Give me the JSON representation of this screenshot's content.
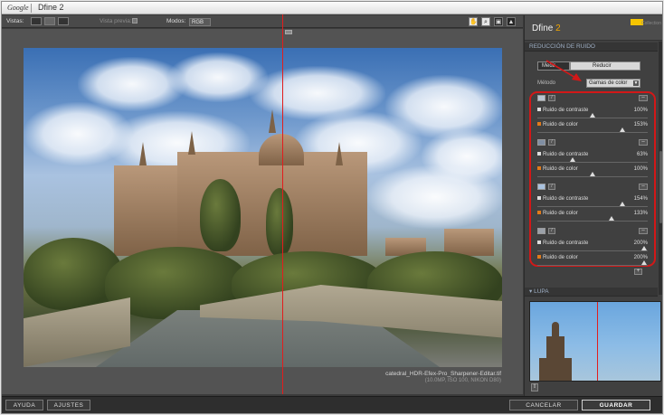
{
  "titlebar": {
    "brand": "Google",
    "title": "Dfine 2"
  },
  "toolbar": {
    "vistas_label": "Vistas:",
    "vista_previa_label": "Vista previa:",
    "modos_label": "Modos:",
    "modo_value": "RGB"
  },
  "photo": {
    "filename": "catedral_HDR-Efex-Pro_Sharpener-Editar.tif",
    "info": "(10.0MP, ISO 100, NIKON D80)"
  },
  "panel": {
    "product_name": "Dfine",
    "product_version": "2",
    "collection_label": "Collection",
    "section_title": "REDUCCIÓN DE RUIDO",
    "tab_medir": "Medir",
    "tab_reducir": "Reducir",
    "metodo_label": "Método",
    "metodo_value": "Gamas de color",
    "groups": [
      {
        "swatch": "#b9c4d1",
        "contrast_label": "Ruido de contraste",
        "contrast_value": "100%",
        "contrast_pos": 0.5,
        "color_label": "Ruido de color",
        "color_value": "153%",
        "color_pos": 0.77
      },
      {
        "swatch": "#7f8ea3",
        "contrast_label": "Ruido de contraste",
        "contrast_value": "63%",
        "contrast_pos": 0.32,
        "color_label": "Ruido de color",
        "color_value": "100%",
        "color_pos": 0.5
      },
      {
        "swatch": "#a8c1de",
        "contrast_label": "Ruido de contraste",
        "contrast_value": "154%",
        "contrast_pos": 0.77,
        "color_label": "Ruido de color",
        "color_value": "133%",
        "color_pos": 0.67
      },
      {
        "swatch": "#9aa0a8",
        "contrast_label": "Ruido de contraste",
        "contrast_value": "200%",
        "contrast_pos": 0.97,
        "color_label": "Ruido de color",
        "color_value": "200%",
        "color_pos": 0.97
      }
    ],
    "lupa_title": "LUPA"
  },
  "bottom": {
    "ayuda": "AYUDA",
    "ajustes": "AJUSTES",
    "cancelar": "CANCELAR",
    "guardar": "GUARDAR"
  },
  "colors": {
    "accent": "#f0a500",
    "annotation": "#d21818",
    "nik_badge": "#f5c400"
  }
}
